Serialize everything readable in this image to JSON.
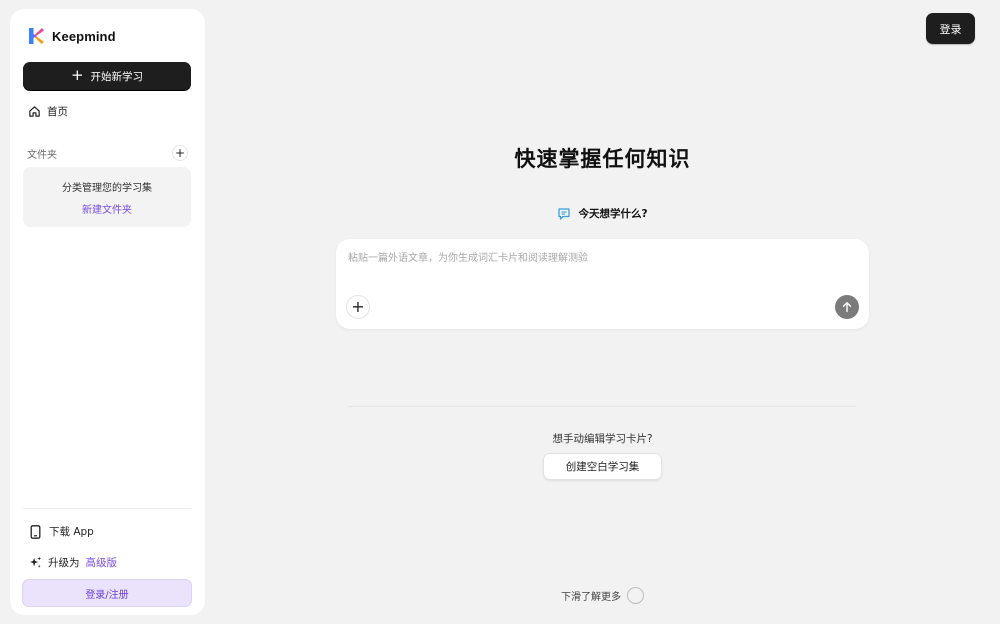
{
  "sidebar": {
    "brand_name": "Keepmind",
    "new_study_label": "开始新学习",
    "home_label": "首页",
    "folders_title": "文件夹",
    "folder_add_icon": "+",
    "folder_hint": "分类管理您的学习集",
    "new_folder_link": "新建文件夹",
    "download_app_label": "下载 App",
    "upgrade_prefix": "升级为",
    "upgrade_pro": "高级版",
    "login_register_label": "登录/注册"
  },
  "header": {
    "login_label": "登录"
  },
  "main": {
    "headline": "快速掌握任何知识",
    "prompt_question": "今天想学什么?",
    "composer_placeholder": "粘贴一篇外语文章，为你生成词汇卡片和阅读理解测验",
    "composer_value": "",
    "attach_icon": "+",
    "manual_question": "想手动编辑学习卡片?",
    "create_blank_label": "创建空白学习集",
    "scroll_hint": "下滑了解更多"
  },
  "icons": {
    "brand": "keepmind-logo",
    "home": "home-icon",
    "phone": "phone-icon",
    "sparkle": "sparkle-icon",
    "chat": "chat-bubble-icon",
    "send": "arrow-up-icon"
  },
  "colors": {
    "accent_purple": "#7a4de0",
    "dark_button": "#1e1e1e",
    "background": "#f2f2f2",
    "login_register_bg": "#eae3fb",
    "send_button": "#7b7b7b"
  }
}
